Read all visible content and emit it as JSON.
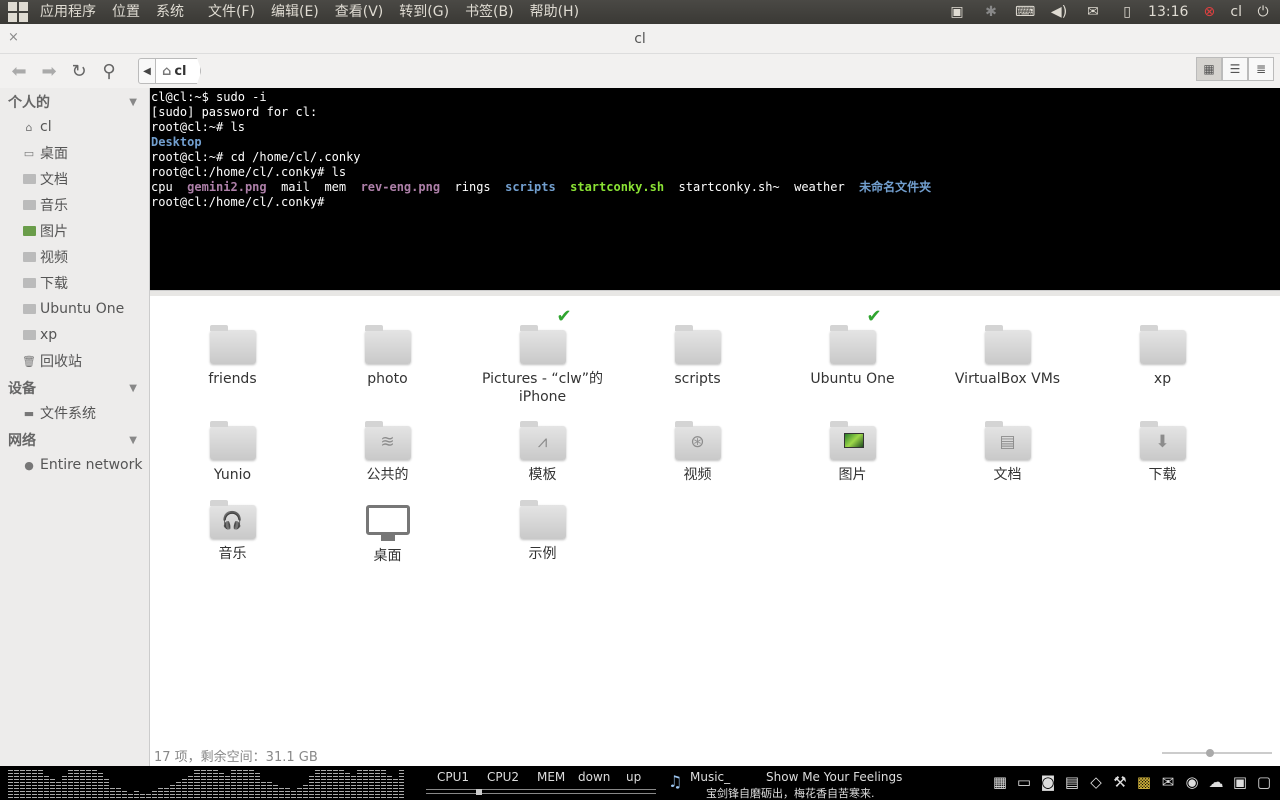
{
  "top_panel": {
    "menus": [
      "应用程序",
      "位置",
      "系统",
      "文件(F)",
      "编辑(E)",
      "查看(V)",
      "转到(G)",
      "书签(B)",
      "帮助(H)"
    ],
    "clock": "13:16",
    "user": "cl"
  },
  "window": {
    "title": "cl",
    "close_label": "×"
  },
  "toolbar": {
    "path_segment": "cl"
  },
  "sidebar": {
    "personal_heading": "个人的",
    "personal": [
      "cl",
      "桌面",
      "文档",
      "音乐",
      "图片",
      "视频",
      "下载",
      "Ubuntu One",
      "xp",
      "回收站"
    ],
    "devices_heading": "设备",
    "devices": [
      "文件系统"
    ],
    "network_heading": "网络",
    "network": [
      "Entire network"
    ]
  },
  "terminal": {
    "lines": [
      "cl@cl:~$ sudo -i",
      "[sudo] password for cl:",
      "root@cl:~# ls",
      "Desktop",
      "root@cl:~# cd /home/cl/.conky",
      "root@cl:/home/cl/.conky# ls",
      "",
      "root@cl:/home/cl/.conky#"
    ],
    "ls_items": [
      {
        "name": "cpu",
        "kind": "plain"
      },
      {
        "name": "gemini2.png",
        "kind": "img"
      },
      {
        "name": "mail",
        "kind": "plain"
      },
      {
        "name": "mem",
        "kind": "plain"
      },
      {
        "name": "rev-eng.png",
        "kind": "img"
      },
      {
        "name": "rings",
        "kind": "plain"
      },
      {
        "name": "scripts",
        "kind": "dir"
      },
      {
        "name": "startconky.sh",
        "kind": "exe"
      },
      {
        "name": "startconky.sh~",
        "kind": "plain"
      },
      {
        "name": "weather",
        "kind": "plain"
      },
      {
        "name": "未命名文件夹",
        "kind": "dir"
      }
    ]
  },
  "files": {
    "items": [
      {
        "name": "friends",
        "icon": "folder"
      },
      {
        "name": "photo",
        "icon": "folder"
      },
      {
        "name": "Pictures - “clw”的 iPhone",
        "icon": "folder",
        "synced": true
      },
      {
        "name": "scripts",
        "icon": "folder"
      },
      {
        "name": "Ubuntu One",
        "icon": "folder",
        "synced": true
      },
      {
        "name": "VirtualBox VMs",
        "icon": "folder"
      },
      {
        "name": "xp",
        "icon": "folder"
      },
      {
        "name": "Yunio",
        "icon": "folder"
      },
      {
        "name": "公共的",
        "icon": "folder-public"
      },
      {
        "name": "模板",
        "icon": "folder-templates"
      },
      {
        "name": "视频",
        "icon": "folder-videos"
      },
      {
        "name": "图片",
        "icon": "folder-pictures"
      },
      {
        "name": "文档",
        "icon": "folder-documents"
      },
      {
        "name": "下载",
        "icon": "folder-downloads"
      },
      {
        "name": "音乐",
        "icon": "folder-music"
      },
      {
        "name": "桌面",
        "icon": "desktop"
      },
      {
        "name": "示例",
        "icon": "folder"
      }
    ],
    "status": "17 项，剩余空间：31.1 GB"
  },
  "bottom_panel": {
    "meters": [
      "CPU1",
      "CPU2",
      "MEM",
      "down",
      "up"
    ],
    "music_label": "Music_",
    "song": "Show Me Your Feelings",
    "lyric": "宝剑锋自磨砺出，梅花香自苦寒来."
  }
}
